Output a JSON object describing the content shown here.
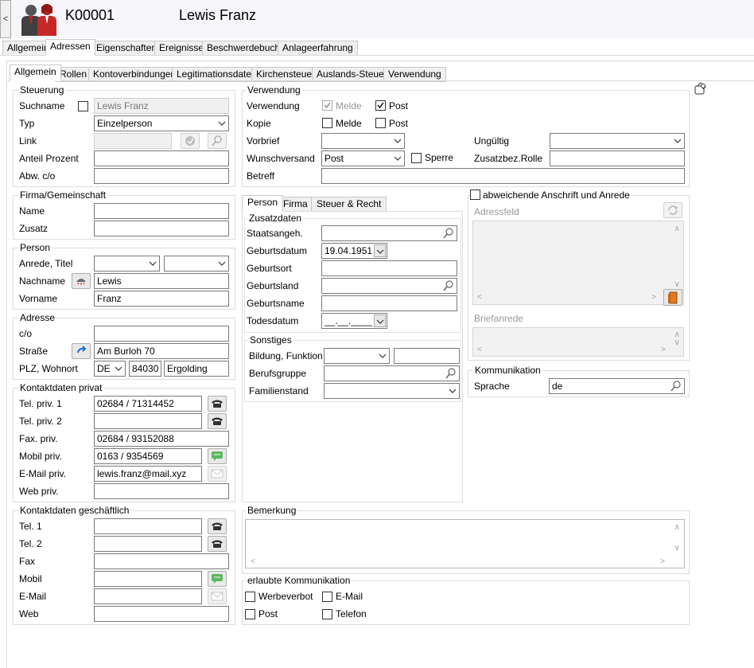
{
  "header": {
    "collapse_label": "<",
    "customer_id": "K00001",
    "customer_name": "Lewis Franz"
  },
  "main_tabs": [
    "Allgemein",
    "Adressen",
    "Eigenschaften",
    "Ereignisse",
    "Beschwerdebuch",
    "Anlageerfahrung"
  ],
  "sub_tabs": [
    "Allgemein",
    "Rollen",
    "Kontoverbindungen",
    "Legitimationsdaten",
    "Kirchensteuer",
    "Auslands-Steuer",
    "Verwendung"
  ],
  "steuerung": {
    "title": "Steuerung",
    "suchname_label": "Suchname",
    "suchname_value": "Lewis Franz",
    "typ_label": "Typ",
    "typ_value": "Einzelperson",
    "link_label": "Link",
    "anteil_label": "Anteil Prozent",
    "abw_label": "Abw. c/o"
  },
  "firma": {
    "title": "Firma/Gemeinschaft",
    "name_label": "Name",
    "zusatz_label": "Zusatz"
  },
  "person": {
    "title": "Person",
    "anrede_label": "Anrede, Titel",
    "nachname_label": "Nachname",
    "nachname_value": "Lewis",
    "vorname_label": "Vorname",
    "vorname_value": "Franz"
  },
  "adresse": {
    "title": "Adresse",
    "co_label": "c/o",
    "strasse_label": "Straße",
    "strasse_value": "Am Burloh 70",
    "plz_label": "PLZ, Wohnort",
    "country": "DE",
    "plz": "84030",
    "ort": "Ergolding"
  },
  "kontakt_privat": {
    "title": "Kontaktdaten privat",
    "tel1_label": "Tel. priv. 1",
    "tel1_value": "02684 / 71314452",
    "tel2_label": "Tel. priv. 2",
    "fax_label": "Fax. priv.",
    "fax_value": "02684 / 93152088",
    "mobil_label": "Mobil priv.",
    "mobil_value": "0163 / 9354569",
    "email_label": "E-Mail priv.",
    "email_value": "lewis.franz@mail.xyz",
    "web_label": "Web priv."
  },
  "kontakt_geschaeft": {
    "title": "Kontaktdaten geschäftlich",
    "tel1_label": "Tel. 1",
    "tel2_label": "Tel. 2",
    "fax_label": "Fax",
    "mobil_label": "Mobil",
    "email_label": "E-Mail",
    "web_label": "Web"
  },
  "verwendung": {
    "title": "Verwendung",
    "verwendung_label": "Verwendung",
    "melde": "Melde",
    "post": "Post",
    "kopie_label": "Kopie",
    "vorbrief_label": "Vorbrief",
    "wunsch_label": "Wunschversand",
    "wunsch_value": "Post",
    "sperre": "Sperre",
    "betreff_label": "Betreff",
    "ungueltig_label": "Ungültig",
    "zusatzbez_label": "Zusatzbez.Rolle"
  },
  "person_tabs": [
    "Person",
    "Firma",
    "Steuer & Recht"
  ],
  "zusatzdaten": {
    "title": "Zusatzdaten",
    "staatsangeh_label": "Staatsangeh.",
    "geburtsdatum_label": "Geburtsdatum",
    "geburtsdatum_value": "19.04.1951",
    "geburtsort_label": "Geburtsort",
    "geburtsland_label": "Geburtsland",
    "geburtsname_label": "Geburtsname",
    "todesdatum_label": "Todesdatum",
    "todesdatum_value": "__.__.____"
  },
  "sonstiges": {
    "title": "Sonstiges",
    "bildung_label": "Bildung, Funktion",
    "berufsgruppe_label": "Berufsgruppe",
    "familienstand_label": "Familienstand"
  },
  "anschrift": {
    "title": "abweichende Anschrift und Anrede",
    "adressfeld_label": "Adressfeld",
    "briefanrede_label": "Briefanrede"
  },
  "kommunikation": {
    "title": "Kommunikation",
    "sprache_label": "Sprache",
    "sprache_value": "de"
  },
  "bemerkung": {
    "title": "Bemerkung"
  },
  "erlaubte": {
    "title": "erlaubte Kommunikation",
    "werbeverbot": "Werbeverbot",
    "email": "E-Mail",
    "post": "Post",
    "telefon": "Telefon"
  }
}
